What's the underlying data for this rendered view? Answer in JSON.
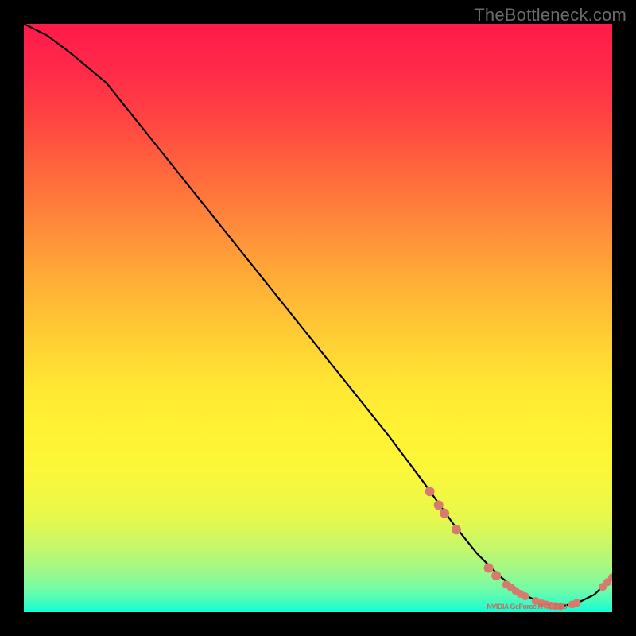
{
  "watermark": "TheBottleneck.com",
  "chart_data": {
    "type": "line",
    "title": "",
    "xlabel": "",
    "ylabel": "",
    "xlim": [
      0,
      100
    ],
    "ylim": [
      0,
      100
    ],
    "curve": {
      "x": [
        0,
        4,
        8,
        14,
        22,
        30,
        38,
        46,
        54,
        62,
        68,
        73,
        77,
        81,
        85,
        88,
        91,
        94,
        97,
        100
      ],
      "y": [
        100,
        98,
        95,
        90,
        80,
        70,
        60,
        50,
        40,
        30,
        22,
        15,
        10,
        6,
        3,
        1.5,
        1,
        1.5,
        3,
        6
      ]
    },
    "series": [
      {
        "name": "points",
        "points": [
          {
            "x": 69.0,
            "y": 20.5,
            "r": 6
          },
          {
            "x": 70.5,
            "y": 18.2,
            "r": 6
          },
          {
            "x": 71.5,
            "y": 16.8,
            "r": 6
          },
          {
            "x": 73.5,
            "y": 14.0,
            "r": 6
          },
          {
            "x": 79.0,
            "y": 7.5,
            "r": 6
          },
          {
            "x": 80.3,
            "y": 6.2,
            "r": 6
          },
          {
            "x": 82.0,
            "y": 4.7,
            "r": 5
          },
          {
            "x": 82.8,
            "y": 4.2,
            "r": 5
          },
          {
            "x": 83.6,
            "y": 3.6,
            "r": 5
          },
          {
            "x": 84.4,
            "y": 3.1,
            "r": 5
          },
          {
            "x": 85.2,
            "y": 2.7,
            "r": 5
          },
          {
            "x": 87.0,
            "y": 1.9,
            "r": 5
          },
          {
            "x": 88.0,
            "y": 1.5,
            "r": 5
          },
          {
            "x": 88.8,
            "y": 1.3,
            "r": 5
          },
          {
            "x": 89.6,
            "y": 1.1,
            "r": 5
          },
          {
            "x": 90.4,
            "y": 1.05,
            "r": 5
          },
          {
            "x": 91.2,
            "y": 1.0,
            "r": 5
          },
          {
            "x": 93.2,
            "y": 1.3,
            "r": 5
          },
          {
            "x": 94.0,
            "y": 1.6,
            "r": 5
          },
          {
            "x": 98.4,
            "y": 4.3,
            "r": 5
          },
          {
            "x": 99.2,
            "y": 5.1,
            "r": 5
          },
          {
            "x": 100.0,
            "y": 5.9,
            "r": 5
          }
        ]
      }
    ],
    "annotations": [
      {
        "x": 85.5,
        "y": 2.2,
        "text": "NVIDIA GeForce RTX 3060"
      }
    ]
  }
}
